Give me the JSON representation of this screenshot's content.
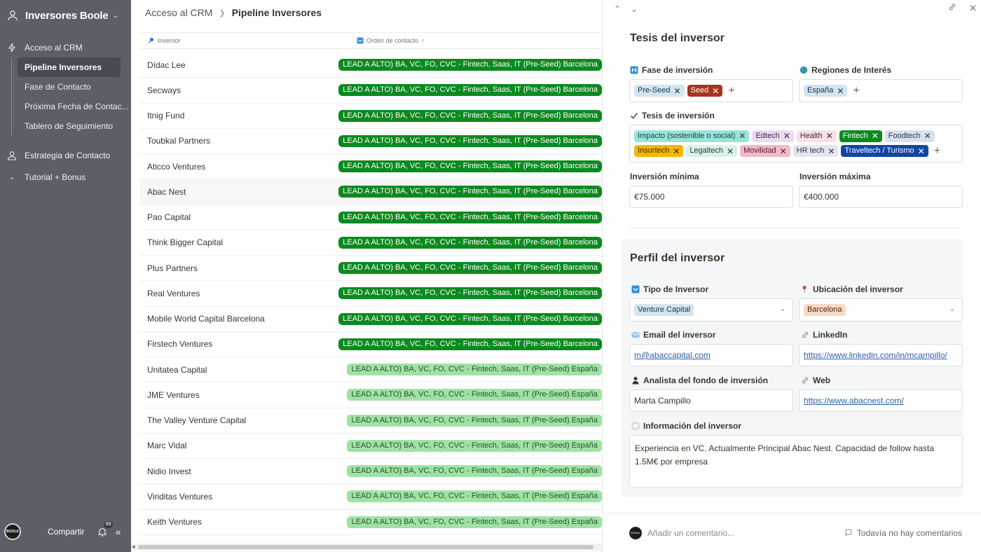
{
  "workspace": {
    "title": "Inversores Boole"
  },
  "sidebar": {
    "items": [
      {
        "label": "Acceso al CRM"
      },
      {
        "label": "Pipeline Inversores"
      },
      {
        "label": "Fase de Contacto"
      },
      {
        "label": "Próxima Fecha de Contac..."
      },
      {
        "label": "Tablero de Seguimiento"
      },
      {
        "label": "Estrategia de Contacto"
      },
      {
        "label": "Tutorial + Bonus"
      }
    ],
    "avatar_text": "BOOLE",
    "share_label": "Compartir",
    "notif_count": "88"
  },
  "breadcrumb": {
    "parent": "Acceso al CRM",
    "current": "Pipeline Inversores"
  },
  "table": {
    "col_inversor": "Inversor",
    "col_orden": "Orden de contacto",
    "tag_dark": "LEAD A ALTO) BA, VC, FO, CVC - Fintech, Saas, IT (Pre-Seed) Barcelona",
    "tag_light": "LEAD A ALTO) BA, VC, FO, CVC - Fintech, Saas, IT (Pre-Seed) España",
    "rows": [
      {
        "name": "Dídac Lee",
        "tag": "dark"
      },
      {
        "name": "Secways",
        "tag": "dark"
      },
      {
        "name": "Itnig Fund",
        "tag": "dark"
      },
      {
        "name": "Toubkal Partners",
        "tag": "dark"
      },
      {
        "name": "Aticco Ventures",
        "tag": "dark"
      },
      {
        "name": "Abac Nest",
        "tag": "dark"
      },
      {
        "name": "Pao Capital",
        "tag": "dark"
      },
      {
        "name": "Think Bigger Capital",
        "tag": "dark"
      },
      {
        "name": "Plus Partners",
        "tag": "dark"
      },
      {
        "name": "Real Ventures",
        "tag": "dark"
      },
      {
        "name": "Mobile World Capital Barcelona",
        "tag": "dark"
      },
      {
        "name": "Firstech Ventures",
        "tag": "dark"
      },
      {
        "name": "Unitatea Capital",
        "tag": "light"
      },
      {
        "name": "JME Ventures",
        "tag": "light"
      },
      {
        "name": "The Valley Venture Capital",
        "tag": "light"
      },
      {
        "name": "Marc Vidal",
        "tag": "light"
      },
      {
        "name": "Nidio Invest",
        "tag": "light"
      },
      {
        "name": "Viriditas Ventures",
        "tag": "light"
      },
      {
        "name": "Keith Ventures",
        "tag": "light"
      }
    ]
  },
  "panel": {
    "tesis_title": "Tesis del inversor",
    "fase_label": "Fase de inversión",
    "fase_chips": [
      {
        "label": "Pre-Seed",
        "bg": "#d3e5ef",
        "fg": "#183347"
      },
      {
        "label": "Seed",
        "bg": "#a8331e",
        "fg": "#ffffff"
      }
    ],
    "regiones_label": "Regiones de Interés",
    "regiones_chips": [
      {
        "label": "España",
        "bg": "#d3e5ef",
        "fg": "#183347"
      }
    ],
    "tesis_label": "Tesis de inversión",
    "tesis_chips": [
      {
        "label": "Impacto (sostenible o social)",
        "bg": "#9be3d9",
        "fg": "#1d3b37"
      },
      {
        "label": "Edtech",
        "bg": "#e8deee",
        "fg": "#412454"
      },
      {
        "label": "Health",
        "bg": "#f5e0e9",
        "fg": "#4c2337"
      },
      {
        "label": "Fintech",
        "bg": "#0c8a1f",
        "fg": "#ffffff"
      },
      {
        "label": "Foodtech",
        "bg": "#d8e1ef",
        "fg": "#28344a"
      },
      {
        "label": "Insurtech",
        "bg": "#f5b800",
        "fg": "#3b2c00"
      },
      {
        "label": "Legaltech",
        "bg": "#dcefe9",
        "fg": "#1f3d35"
      },
      {
        "label": "Movilidad",
        "bg": "#f3b9c9",
        "fg": "#4d1e2b"
      },
      {
        "label": "HR tech",
        "bg": "#e3e7ef",
        "fg": "#2b3244"
      },
      {
        "label": "Traveltech / Turismo",
        "bg": "#1246a3",
        "fg": "#ffffff"
      }
    ],
    "min_label": "Inversión mínima",
    "min_value": "€75.000",
    "max_label": "Inversión máxima",
    "max_value": "€400.000",
    "perfil_title": "Perfil del inversor",
    "tipo_label": "Tipo de Inversor",
    "tipo_value": "Venture Capital",
    "ubic_label": "Ubicación del inversor",
    "ubic_value": "Barcelona",
    "email_label": "Email del inversor",
    "email_value": "m@abaccapital.com",
    "linkedin_label": "LinkedIn",
    "linkedin_value": "https://www.linkedin.com/in/mcampillo/",
    "analista_label": "Analista del fondo de inversión",
    "analista_value": "Marta Campillo",
    "web_label": "Web",
    "web_value": "https://www.abacnest.com/",
    "info_label": "Información del inversor",
    "info_value": "Experiencia en VC. Actualmente Principal Abac Nest. Capacidad de follow hasta 1.5M€ por empresa",
    "comment_placeholder": "Añadir un comentario...",
    "no_comments": "Todavía no hay comentarios"
  }
}
